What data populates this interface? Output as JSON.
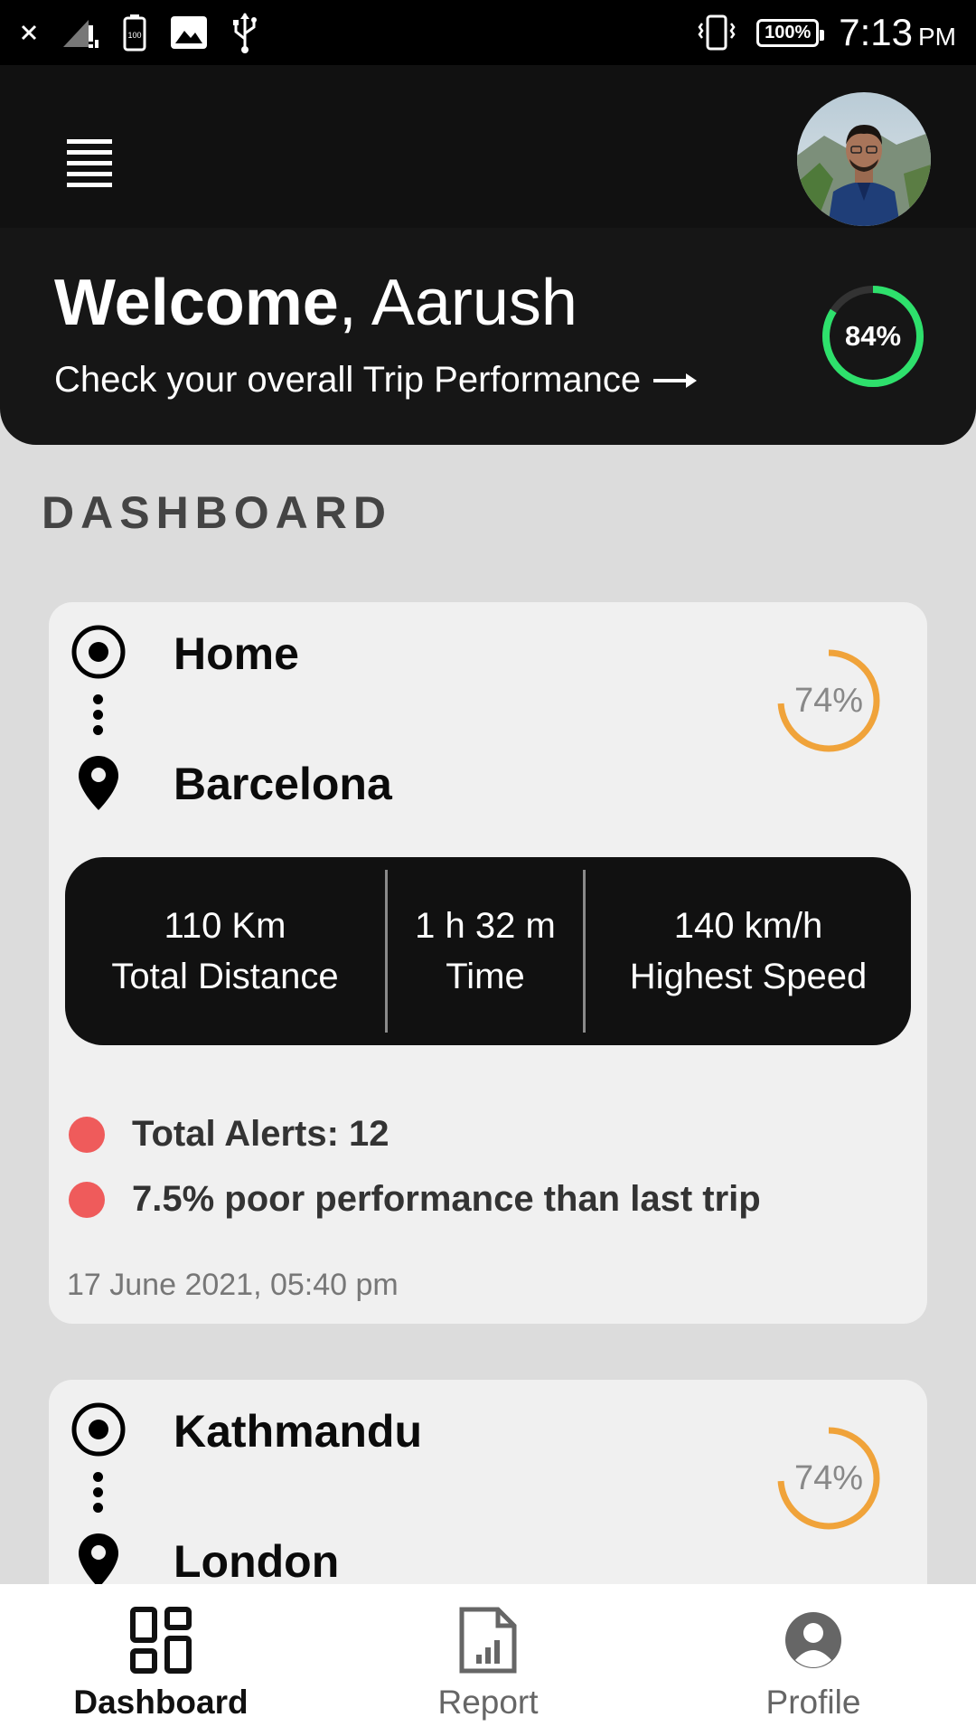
{
  "status_bar": {
    "time": "7:13",
    "ampm": "PM",
    "battery": "100%",
    "icons": [
      "close-icon",
      "signal-icon",
      "battery-small-icon",
      "image-icon",
      "usb-icon",
      "vibrate-icon"
    ]
  },
  "header": {
    "menu_icon": "menu-icon",
    "avatar_icon": "avatar-photo"
  },
  "welcome": {
    "greeting": "Welcome",
    "separator": ",",
    "name": "Aarush",
    "subtitle": "Check your overall Trip Performance",
    "overall_score": "84%",
    "overall_score_value": 84,
    "accent_color": "#2ee06c"
  },
  "dashboard": {
    "title": "DASHBOARD",
    "trips": [
      {
        "from": "Home",
        "to": "Barcelona",
        "score": "74%",
        "score_value": 74,
        "score_color": "#f0a33a",
        "distance_value": "110 Km",
        "distance_label": "Total Distance",
        "time_value": "1 h 32 m",
        "time_label": "Time",
        "speed_value": "140 km/h",
        "speed_label": "Highest Speed",
        "alerts": "Total Alerts: 12",
        "performance": "7.5% poor performance than last trip",
        "date": "17 June 2021, 05:40 pm"
      },
      {
        "from": "Kathmandu",
        "to": "London",
        "score": "74%",
        "score_value": 74,
        "score_color": "#f0a33a"
      }
    ]
  },
  "bottom_nav": {
    "items": [
      {
        "label": "Dashboard",
        "icon": "dashboard-icon",
        "active": true
      },
      {
        "label": "Report",
        "icon": "report-icon",
        "active": false
      },
      {
        "label": "Profile",
        "icon": "profile-icon",
        "active": false
      }
    ]
  }
}
